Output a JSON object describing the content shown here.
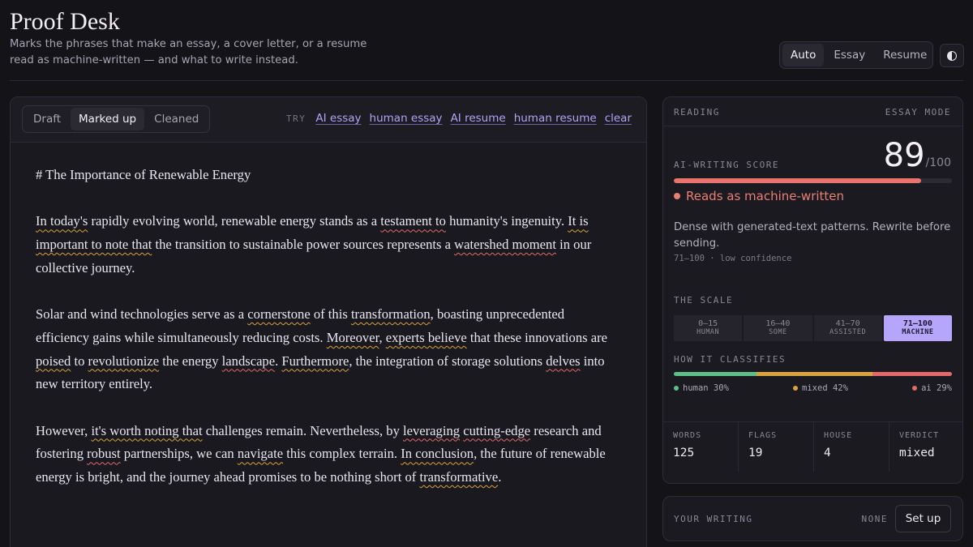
{
  "header": {
    "title": "Proof Desk",
    "subtitle": "Marks the phrases that make an essay, a cover letter, or a resume read as machine-written — and what to write instead."
  },
  "mode_switch": {
    "options": [
      "Auto",
      "Essay",
      "Resume"
    ],
    "selected": "Auto"
  },
  "theme_toggle": {
    "icon": "contrast-icon"
  },
  "editor": {
    "tabs": [
      "Draft",
      "Marked up",
      "Cleaned"
    ],
    "active_tab": "Marked up",
    "try_label": "TRY",
    "samples": [
      "AI essay",
      "human essay",
      "AI resume",
      "human resume",
      "clear"
    ],
    "document": [
      [
        {
          "t": "# The Importance of Renewable Energy"
        }
      ],
      [
        {
          "t": "In today's",
          "f": "y"
        },
        {
          "t": " rapidly evolving world, renewable energy stands as a "
        },
        {
          "t": "testament to",
          "f": "r"
        },
        {
          "t": " humanity's ingenuity. "
        },
        {
          "t": "It is important to note that",
          "f": "y"
        },
        {
          "t": " the transition to sustainable power sources represents a "
        },
        {
          "t": "watershed moment",
          "f": "r"
        },
        {
          "t": " in our collective journey."
        }
      ],
      [
        {
          "t": "Solar and wind technologies serve as a "
        },
        {
          "t": "cornerstone",
          "f": "y"
        },
        {
          "t": " of this "
        },
        {
          "t": "transformation",
          "f": "y"
        },
        {
          "t": ", boasting unprecedented efficiency gains while simultaneously reducing costs. "
        },
        {
          "t": "Moreover",
          "f": "y"
        },
        {
          "t": ", "
        },
        {
          "t": "experts believe",
          "f": "y"
        },
        {
          "t": " that these innovations are "
        },
        {
          "t": "poised",
          "f": "y"
        },
        {
          "t": " to "
        },
        {
          "t": "revolutionize",
          "f": "y"
        },
        {
          "t": " the energy "
        },
        {
          "t": "landscape",
          "f": "r"
        },
        {
          "t": ". "
        },
        {
          "t": "Furthermore",
          "f": "y"
        },
        {
          "t": ", the integration of storage solutions "
        },
        {
          "t": "delves",
          "f": "r"
        },
        {
          "t": " into new territory entirely."
        }
      ],
      [
        {
          "t": "However, "
        },
        {
          "t": "it's worth noting that",
          "f": "y"
        },
        {
          "t": " challenges remain. Nevertheless, by "
        },
        {
          "t": "leveraging",
          "f": "r"
        },
        {
          "t": " "
        },
        {
          "t": "cutting-edge",
          "f": "r"
        },
        {
          "t": " research and fostering "
        },
        {
          "t": "robust",
          "f": "r"
        },
        {
          "t": " partnerships, we can "
        },
        {
          "t": "navigate",
          "f": "y"
        },
        {
          "t": " this complex terrain. "
        },
        {
          "t": "In conclusion",
          "f": "y"
        },
        {
          "t": ", the future of renewable energy is bright, and the journey ahead promises to be nothing short of "
        },
        {
          "t": "transformative",
          "f": "y"
        },
        {
          "t": "."
        }
      ]
    ]
  },
  "reading": {
    "label": "READING",
    "mode_label": "ESSAY MODE",
    "score_label": "AI-WRITING SCORE",
    "score": 89,
    "score_max_text": "/100",
    "score_fraction": 0.89,
    "verdict": "Reads as machine-written",
    "description": "Dense with generated-text patterns. Rewrite before sending.",
    "range_note": "71–100 · low confidence",
    "scale_label": "THE SCALE",
    "scale": [
      {
        "range": "0–15",
        "name": "HUMAN"
      },
      {
        "range": "16–40",
        "name": "SOME"
      },
      {
        "range": "41–70",
        "name": "ASSISTED"
      },
      {
        "range": "71–100",
        "name": "MACHINE"
      }
    ],
    "scale_active": 3,
    "classify_label": "HOW IT CLASSIFIES",
    "classify": [
      {
        "label": "human 30%",
        "share": 30,
        "color": "#5cc189"
      },
      {
        "label": "mixed 42%",
        "share": 42,
        "color": "#d9a43b"
      },
      {
        "label": "ai 29%",
        "share": 29,
        "color": "#e46a6a"
      }
    ],
    "stats": [
      {
        "label": "WORDS",
        "value": "125"
      },
      {
        "label": "FLAGS",
        "value": "19"
      },
      {
        "label": "HOUSE",
        "value": "4"
      },
      {
        "label": "VERDICT",
        "value": "mixed"
      }
    ]
  },
  "your_writing": {
    "label": "YOUR WRITING",
    "status": "NONE",
    "button": "Set up"
  }
}
